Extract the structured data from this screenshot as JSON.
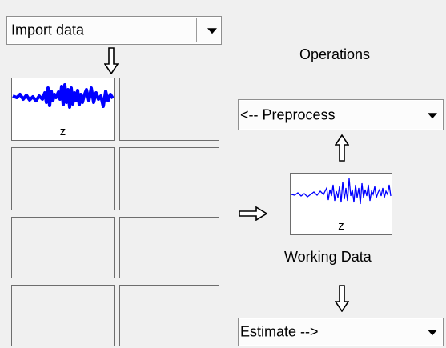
{
  "import_dropdown": {
    "label": "Import data"
  },
  "data_board": {
    "slots": [
      {
        "channel": "z",
        "filled": true
      },
      {
        "channel": "",
        "filled": false
      },
      {
        "channel": "",
        "filled": false
      },
      {
        "channel": "",
        "filled": false
      },
      {
        "channel": "",
        "filled": false
      },
      {
        "channel": "",
        "filled": false
      },
      {
        "channel": "",
        "filled": false
      },
      {
        "channel": "",
        "filled": false
      }
    ]
  },
  "operations": {
    "title": "Operations",
    "preprocess_label": "<-- Preprocess",
    "estimate_label": "Estimate -->"
  },
  "working_data": {
    "channel": "z",
    "caption": "Working Data"
  },
  "icons": {
    "down_arrow": "arrow-down-icon",
    "up_arrow": "arrow-up-icon",
    "right_arrow": "arrow-right-icon",
    "dropdown": "chevron-down-icon"
  },
  "colors": {
    "signal": "#0000ff",
    "panel": "#f0f0f0",
    "plot_bg": "#ffffff",
    "border": "#6d6d6d"
  }
}
